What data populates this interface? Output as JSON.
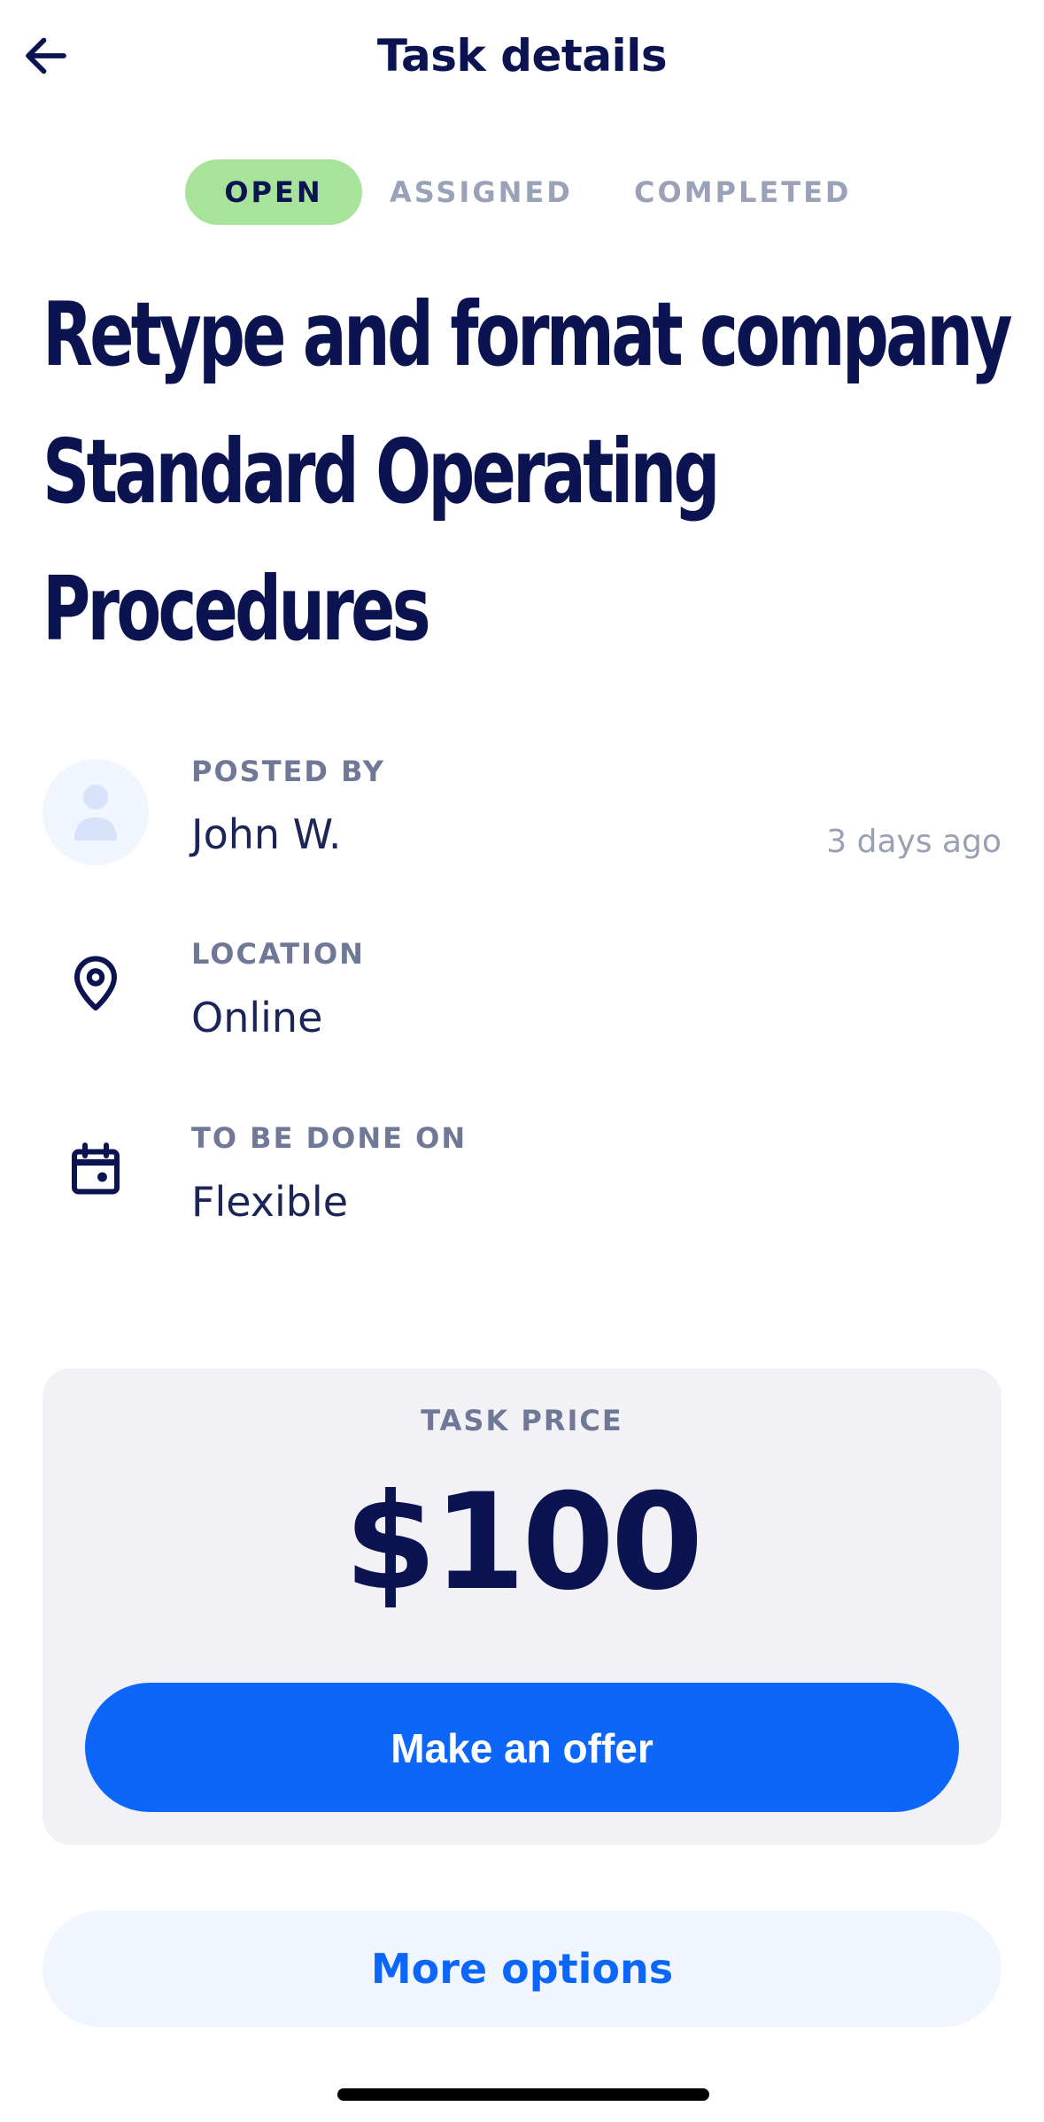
{
  "header": {
    "title": "Task details"
  },
  "status_tabs": [
    {
      "label": "OPEN",
      "active": true
    },
    {
      "label": "ASSIGNED",
      "active": false
    },
    {
      "label": "COMPLETED",
      "active": false
    }
  ],
  "task": {
    "title": "Retype and format company Standard Operating Procedures",
    "posted_by_label": "POSTED BY",
    "posted_by": "John W.",
    "posted_time": "3 days ago",
    "location_label": "LOCATION",
    "location": "Online",
    "due_label": "TO BE DONE ON",
    "due": "Flexible"
  },
  "price": {
    "label": "TASK PRICE",
    "value": "$100",
    "offer_button": "Make an offer"
  },
  "more_options": "More options",
  "colors": {
    "navy": "#0b1451",
    "accent_blue": "#0c66fa",
    "open_badge": "#a7e39a",
    "card_bg": "#f2f2f6"
  },
  "icons": [
    "back-arrow-icon",
    "user-avatar-icon",
    "location-pin-icon",
    "calendar-icon"
  ]
}
